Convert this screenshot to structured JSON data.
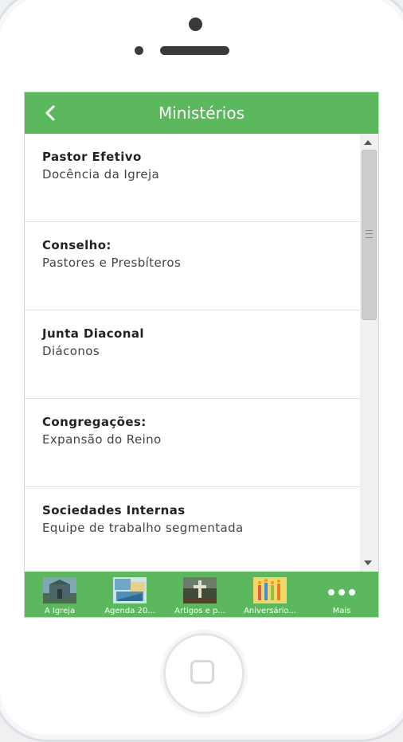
{
  "header": {
    "title": "Ministérios",
    "back_icon": "chevron-left-icon"
  },
  "colors": {
    "accent": "#5cb85c",
    "text": "#222222"
  },
  "items": [
    {
      "title": "Pastor Efetivo",
      "subtitle": "Docência da Igreja"
    },
    {
      "title": "Conselho:",
      "subtitle": "Pastores e Presbíteros"
    },
    {
      "title": "Junta Diaconal",
      "subtitle": "Diáconos"
    },
    {
      "title": "Congregações:",
      "subtitle": "Expansão do Reino"
    },
    {
      "title": "Sociedades Internas",
      "subtitle": "Equipe de trabalho segmentada"
    }
  ],
  "tabs": [
    {
      "label": "A Igreja",
      "icon": "church-photo-icon"
    },
    {
      "label": "Agenda 20...",
      "icon": "calendar-photo-icon"
    },
    {
      "label": "Artigos e p...",
      "icon": "cross-photo-icon"
    },
    {
      "label": "Aniversário...",
      "icon": "birthday-candles-icon"
    },
    {
      "label": "Mais",
      "icon": "more-dots-icon"
    }
  ]
}
